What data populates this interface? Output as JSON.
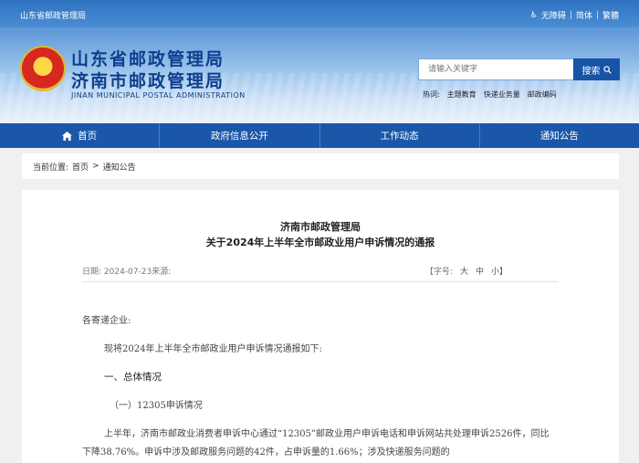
{
  "topbar": {
    "site_name": "山东省邮政管理局",
    "accessibility": "无障碍",
    "simplified": "简体",
    "traditional": "繁體",
    "separator": "|"
  },
  "header": {
    "org_line1": "山东省邮政管理局",
    "org_line2": "济南市邮政管理局",
    "org_english": "JINAN MUNICIPAL POSTAL ADMINISTRATION",
    "emblem_icon": "national-emblem-icon"
  },
  "search": {
    "placeholder": "请输入关键字",
    "button_label": "搜索",
    "hot_label": "热词:",
    "hot_words": [
      "主题教育",
      "快递业务量",
      "邮政编码"
    ]
  },
  "nav": {
    "items": [
      "首页",
      "政府信息公开",
      "工作动态",
      "通知公告"
    ]
  },
  "breadcrumb": {
    "label": "当前位置:",
    "home": "首页",
    "sep": ">",
    "current": "通知公告"
  },
  "article": {
    "title_line1": "济南市邮政管理局",
    "title_line2": "关于2024年上半年全市邮政业用户申诉情况的通报",
    "date_label": "日期: 2024-07-23来源:",
    "fontsize_label": "【字号:",
    "fontsize_large": "大",
    "fontsize_medium": "中",
    "fontsize_small": "小】",
    "salutation": "各寄递企业:",
    "intro": "现将2024年上半年全市邮政业用户申诉情况通报如下:",
    "heading1": "一、总体情况",
    "heading2": "（一）12305申诉情况",
    "paragraph": "上半年，济南市邮政业消费者申诉中心通过“12305”邮政业用户申诉电话和申诉网站共处理申诉2526件，同比下降38.76%。申诉中涉及邮政服务问题的42件，占申诉量的1.66%；涉及快递服务问题的"
  },
  "colors": {
    "nav_blue": "#1a57a8",
    "title_blue": "#0d3f8d"
  }
}
